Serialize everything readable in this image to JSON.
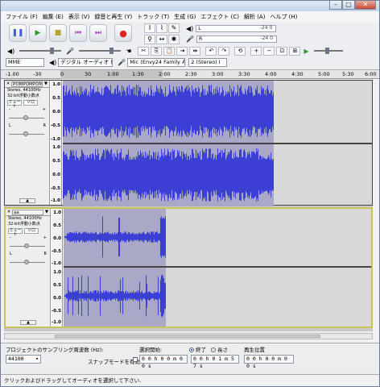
{
  "menu": {
    "items": [
      "ファイル (F)",
      "編集 (E)",
      "表示 (V)",
      "録音と再生 (Y)",
      "トラック (T)",
      "生成 (G)",
      "エフェクト (C)",
      "解析 (A)",
      "ヘルプ (H)"
    ]
  },
  "meters": {
    "playback_ticks": "-24  0",
    "record_ticks": "-24  0",
    "row1_label": "L",
    "row2_label": "R"
  },
  "devices": {
    "host": "MME",
    "output": "デジタル オーディオ (S/F",
    "input": "Mic (Envy24 Family A",
    "channels": "2 (Stereo) I"
  },
  "ruler": {
    "ticks": [
      "-1.00",
      "-30",
      "0",
      "30",
      "1:00",
      "1:30",
      "2:00",
      "2:30",
      "3:00",
      "3:30",
      "4:00",
      "4:30",
      "5:00",
      "5:30",
      "6:00"
    ]
  },
  "tracks": [
    {
      "name": "POMPOMPOMP",
      "info1": "Stereo, 44100Hz",
      "info2": "32-bit浮動小数点",
      "mute": "ミュート",
      "solo": "ソロ",
      "scale": [
        "1.0",
        "0.5",
        "0.0",
        "-0.5",
        "-1.0",
        "1.0",
        "0.5",
        "0.0",
        "-0.5",
        "-1.0"
      ],
      "wave_color": "#3b3fd3"
    },
    {
      "name": "aa",
      "info1": "Stereo, 44100Hz",
      "info2": "32-bit浮動小数点",
      "mute": "ミュート",
      "solo": "ソロ",
      "scale": [
        "1.0",
        "0.5",
        "0.0",
        "-0.5",
        "-1.0",
        "1.0",
        "0.5",
        "0.0",
        "-0.5",
        "-1.0"
      ],
      "wave_color": "#3b3fd3"
    }
  ],
  "pan": {
    "left": "L",
    "right": "R",
    "minus": "-",
    "plus": "+"
  },
  "selection_bar": {
    "rate_label": "プロジェクトのサンプリング周波数 (Hz):",
    "rate_value": "44100",
    "snap_label": "スナップモードを有効",
    "start_label": "選択開始:",
    "end_label": "終了",
    "length_label": "長さ",
    "start_value": "0 0 h 0 0 m 0 0 s",
    "end_value": "0 0 h 0 1 m 5 7 s",
    "position_label": "再生位置",
    "position_value": "0 0 h 0 0 m 0 0 s"
  },
  "status": {
    "text": "クリックおよびドラッグしてオーディオを選択して下さい."
  },
  "colors": {
    "waveform": "#3b3fd3",
    "selection": "#a9a9c7",
    "track_bg": "#d8d8d8",
    "selected_track_border": "#c9c35a"
  }
}
